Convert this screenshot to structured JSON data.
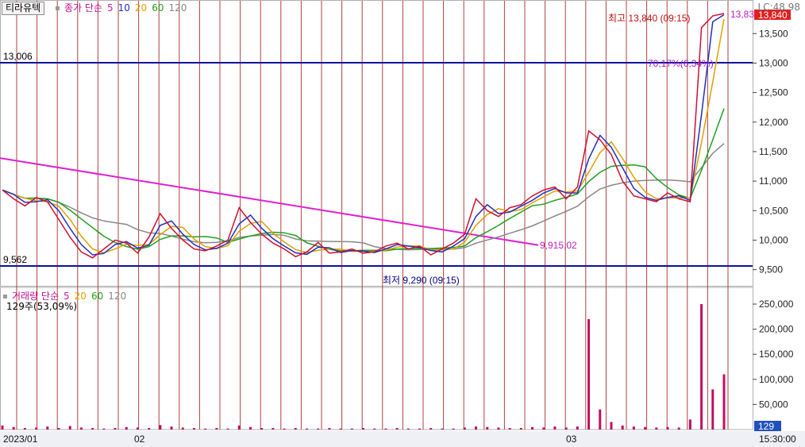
{
  "instrument": {
    "name": "티라유텍"
  },
  "price_legend": {
    "label": "종가 단순",
    "ma": [
      "5",
      "10",
      "20",
      "60",
      "120"
    ],
    "ma_colors": [
      "#d020a0",
      "#2030c0",
      "#e0a000",
      "#20a020",
      "#888888"
    ]
  },
  "volume_legend": {
    "label": "거래량 단순",
    "ma": [
      "5",
      "20",
      "60",
      "120"
    ],
    "ma_colors": [
      "#d020a0",
      "#e0a000",
      "#20a020",
      "#888888"
    ],
    "current": "129주(53,09%)"
  },
  "top_right": {
    "label": "LC:48.98"
  },
  "current_price": {
    "value": "13,840",
    "color": "#e02020"
  },
  "current_volume": {
    "value": "129",
    "color": "#2050c0"
  },
  "time_label": "15:30:00",
  "annotations": {
    "high": "최고 13,840 (09:15)",
    "low": "최저 9,290 (09:15)",
    "trend_end": "9,915,02",
    "pct": "70,17%(6,34%)",
    "trend_top": "13,83"
  },
  "chart_data": [
    {
      "type": "line",
      "title": "",
      "x_labels": [
        "2023/01",
        "02",
        "03"
      ],
      "ylim": [
        9290,
        13840
      ],
      "y_ticks": [
        "13,500",
        "13,000",
        "12,500",
        "12,000",
        "11,500",
        "11,000",
        "10,500",
        "10,000",
        "9,500"
      ],
      "horizontal_lines": [
        {
          "label": "13,006",
          "value": 13006
        },
        {
          "label": "9,562",
          "value": 9562
        }
      ],
      "trendline": {
        "from": 11390,
        "to": 9915.02
      },
      "series": [
        {
          "name": "종가",
          "values": [
            10850,
            10700,
            10580,
            10720,
            10650,
            10350,
            10050,
            9800,
            9700,
            9850,
            10000,
            9950,
            9780,
            10050,
            10450,
            10200,
            10000,
            9850,
            9820,
            9900,
            10000,
            10550,
            10300,
            10100,
            9950,
            9850,
            9720,
            9800,
            9960,
            9780,
            9800,
            9850,
            9780,
            9800,
            9900,
            9950,
            9850,
            9900,
            9750,
            9850,
            9950,
            10100,
            10700,
            10500,
            10400,
            10550,
            10600,
            10750,
            10850,
            10900,
            10700,
            10900,
            11850,
            11700,
            11450,
            11000,
            10750,
            10700,
            10650,
            10800,
            10700,
            10650,
            13600,
            13800,
            13840
          ]
        }
      ]
    },
    {
      "type": "bar",
      "title": "",
      "ylim": [
        0,
        250000
      ],
      "y_ticks": [
        "250,000",
        "200,000",
        "150,000",
        "100,000",
        "50,000"
      ],
      "values": [
        8000,
        5000,
        3000,
        4000,
        6000,
        3000,
        7000,
        4000,
        3000,
        2000,
        3000,
        5000,
        4000,
        3000,
        9000,
        6000,
        4000,
        3000,
        2000,
        3000,
        2000,
        8000,
        5000,
        3000,
        3000,
        2000,
        3000,
        2000,
        2000,
        3000,
        2000,
        2000,
        3000,
        2000,
        2000,
        3000,
        2000,
        2000,
        3000,
        2000,
        2000,
        4000,
        6000,
        5000,
        4000,
        3000,
        3000,
        5000,
        4000,
        6000,
        4000,
        6000,
        220000,
        40000,
        15000,
        8000,
        6000,
        5000,
        4000,
        5000,
        4000,
        20000,
        250000,
        80000,
        110000
      ]
    }
  ]
}
